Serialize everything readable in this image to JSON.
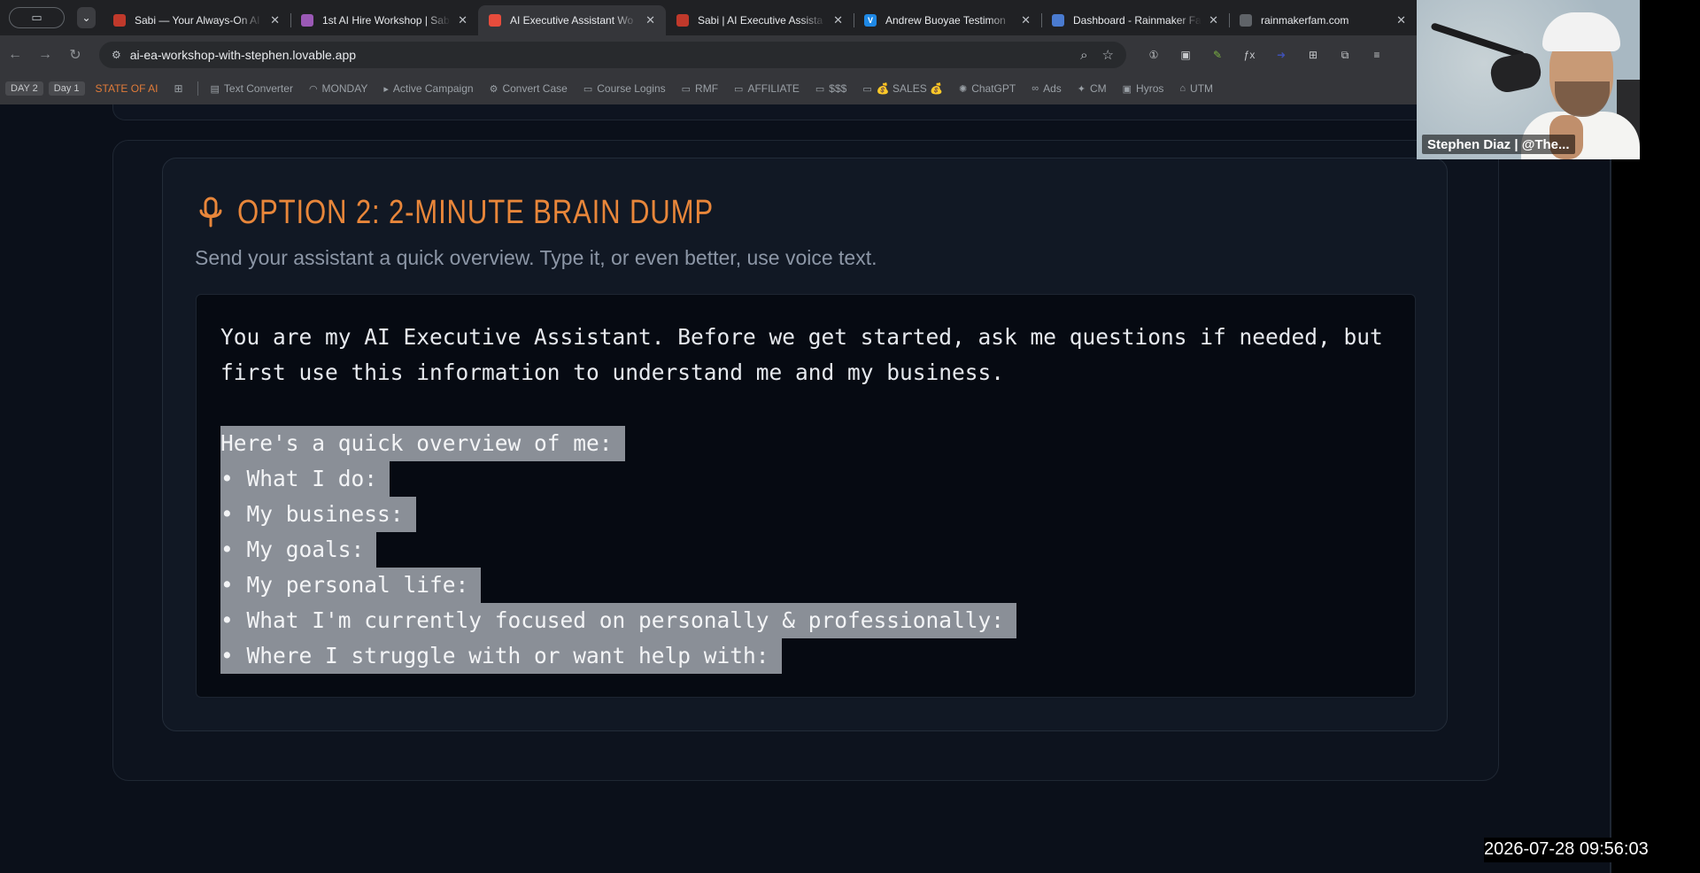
{
  "browser": {
    "tabs": [
      {
        "title": "Sabi — Your Always-On AI",
        "favicon_color": "#c0392b",
        "icon": "sabi-favicon",
        "active": false
      },
      {
        "title": "1st AI Hire Workshop | Sabi",
        "favicon_color": "#9b59b6",
        "icon": "workshop-favicon",
        "active": false
      },
      {
        "title": "AI Executive Assistant Wo",
        "favicon_color": "#e74c3c",
        "icon": "lovable-favicon",
        "active": true
      },
      {
        "title": "Sabi | AI Executive Assista",
        "favicon_color": "#c0392b",
        "icon": "sabi-favicon",
        "active": false
      },
      {
        "title": "Andrew Buoyae Testimon",
        "favicon_color": "#1e88e5",
        "favicon_text": "V",
        "icon": "vimeo-favicon",
        "active": false
      },
      {
        "title": "Dashboard - Rainmaker Fa",
        "favicon_color": "#4a7bd0",
        "icon": "share-favicon",
        "active": false
      },
      {
        "title": "rainmakerfam.com",
        "favicon_color": "#5f6368",
        "icon": "globe-favicon",
        "active": false
      }
    ],
    "url": "ai-ea-workshop-with-stephen.lovable.app",
    "bookmarks": [
      {
        "label": "DAY 2",
        "style": "boxed"
      },
      {
        "label": "Day 1",
        "style": "boxed"
      },
      {
        "label": "STATE OF AI",
        "style": "orange"
      },
      {
        "label": "Text Converter",
        "icon": "converter-icon"
      },
      {
        "label": "MONDAY",
        "icon": "monday-icon"
      },
      {
        "label": "Active Campaign",
        "icon": "activecampaign-icon"
      },
      {
        "label": "Convert Case",
        "icon": "convertcase-icon"
      },
      {
        "label": "Course Logins",
        "icon": "folder-icon"
      },
      {
        "label": "RMF",
        "icon": "folder-icon"
      },
      {
        "label": "AFFILIATE",
        "icon": "folder-icon"
      },
      {
        "label": "$$$",
        "icon": "folder-icon"
      },
      {
        "label": "💰 SALES 💰",
        "icon": "folder-icon"
      },
      {
        "label": "ChatGPT",
        "icon": "chatgpt-icon"
      },
      {
        "label": "Ads",
        "icon": "meta-icon"
      },
      {
        "label": "CM",
        "icon": "cm-icon"
      },
      {
        "label": "Hyros",
        "icon": "hyros-icon"
      },
      {
        "label": "UTM",
        "icon": "utm-icon"
      }
    ]
  },
  "section": {
    "title": "OPTION 2: 2-MINUTE BRAIN DUMP",
    "subtitle": "Send your assistant a quick overview. Type it, or even better, use voice text.",
    "accent_color": "#e8863a",
    "prompt_intro": [
      "You are my AI Executive Assistant. Before we get started, ask me questions if needed, but",
      "first use this information to understand me and my business."
    ],
    "prompt_selected": [
      "Here's a quick overview of me:",
      "• What I do:",
      "• My business:",
      "• My goals:",
      "• My personal life:",
      "• What I'm currently focused on personally & professionally:",
      "• Where I struggle with or want help with:"
    ]
  },
  "webcam": {
    "name_label": "Stephen Diaz | @The..."
  },
  "timestamp": "2026-07-28  09:56:03"
}
